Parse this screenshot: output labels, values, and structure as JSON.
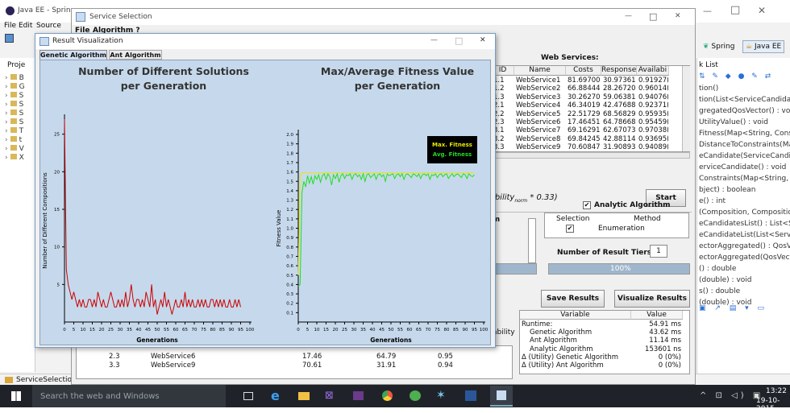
{
  "eclipse": {
    "title": "Java EE - Spring",
    "menu": [
      "File",
      "Edit",
      "Source"
    ],
    "persp_spring": "Spring",
    "persp_javaee": "Java EE",
    "status": "ServiceSelection",
    "win_min": "—",
    "win_max": "□",
    "win_close": "✕",
    "explorer_title": "Proje",
    "task_list": "k List",
    "outline": [
      "tion()",
      "tion(List<ServiceCandidate>,",
      "gregatedQosVector() : void",
      "UtilityValue() : void",
      "Fitness(Map<String, Constrai",
      "DistanceToConstraints(Map<",
      "eCandidate(ServiceCandidat",
      "erviceCandidate() : void",
      "Constraints(Map<String, Cons",
      "bject) : boolean",
      "e() : int",
      "(Composition, Composition)",
      "eCandidatesList() : List<Servi",
      "eCandidateList(List<ServiceC",
      "ectorAggregated() : QosVecto",
      "ectorAggregated(QosVector) :",
      "() : double",
      "(double) : void",
      "s() : double",
      "(double) : void"
    ],
    "tree_letters": [
      "B",
      "G",
      "S",
      "S",
      "S",
      "S",
      "T",
      "t",
      "V",
      "X"
    ]
  },
  "service_window": {
    "title": "Service Selection",
    "menu": [
      "File",
      "Algorithm ?"
    ],
    "min": "—",
    "max": "□",
    "close": "✕",
    "web_services_label": "Web Services:",
    "table_headers": [
      "ID",
      "Name",
      "Costs",
      "Response...",
      "Availabi"
    ],
    "table_rows": [
      [
        "1.1",
        "WebService1",
        "81.697006...",
        "30.973611...",
        "0.91927("
      ],
      [
        "1.2",
        "WebService2",
        "66.884446...",
        "28.267207...",
        "0.96014("
      ],
      [
        "1.3",
        "WebService3",
        "30.262705...",
        "59.063816...",
        "0.94076("
      ],
      [
        "2.1",
        "WebService4",
        "46.340191...",
        "42.476883...",
        "0.92371("
      ],
      [
        "2.2",
        "WebService5",
        "22.517299...",
        "68.568296...",
        "0.95935("
      ],
      [
        "2.3",
        "WebService6",
        "17.464519...",
        "64.786681...",
        "0.95459("
      ],
      [
        "3.1",
        "WebService7",
        "69.162911...",
        "62.670730...",
        "0.97038("
      ],
      [
        "3.2",
        "WebService8",
        "69.842455...",
        "42.881149...",
        "0.93695("
      ],
      [
        "3.3",
        "WebService9",
        "70.608471...",
        "31.908937...",
        "0.94089("
      ]
    ],
    "formula": "ailability",
    "formula_sub": "norm",
    "formula_tail": "* 0.33)",
    "start": "Start",
    "algo_label": "ithm",
    "analytic_label": "Analytic Algorithm",
    "sel_headers": [
      "Selection",
      "Method"
    ],
    "sel_method": "Enumeration",
    "tiers_label": "Number of Result Tiers:",
    "tiers_value": "1",
    "progress": "100%",
    "progress_value": 100,
    "save_btn": "Save Results",
    "visualize_btn": "Visualize Results",
    "res_headers": [
      "Variable",
      "Value"
    ],
    "res_rows": [
      [
        "Runtime:",
        "54.91 ms"
      ],
      [
        "Genetic Algorithm",
        "43.62 ms"
      ],
      [
        "Ant Algorithm",
        "11.14 ms"
      ],
      [
        "Analytic Algorithm",
        "153601 ns"
      ],
      [
        "Δ (Utility) Genetic Algorithm",
        "0 (0%)"
      ],
      [
        "Δ (Utility) Ant Algorithm",
        "0 (0%)"
      ]
    ],
    "bottom_rows": [
      [
        "2.3",
        "WebService6",
        "17.46",
        "64.79",
        "0.95"
      ],
      [
        "3.3",
        "WebService9",
        "70.61",
        "31.91",
        "0.94"
      ]
    ],
    "partial_label": "ability"
  },
  "result_window": {
    "title": "Result Visualization",
    "min": "—",
    "max": "□",
    "close": "✕",
    "tabs": [
      "Genetic Algorithm",
      "Ant Algorithm"
    ]
  },
  "taskbar": {
    "search": "Search the web and Windows",
    "time": "13:22",
    "date": "19-10-2015"
  },
  "chart_data": [
    {
      "type": "line",
      "title": "Number of Different Solutions per Generation",
      "title_lines": [
        "Number of Different Solutions",
        "per Generation"
      ],
      "xlabel": "Generations",
      "ylabel": "Number of Different Compositions",
      "ylim": [
        0,
        27
      ],
      "yticks": [
        5,
        10,
        15,
        20,
        25
      ],
      "xticks": [
        0,
        5,
        10,
        15,
        20,
        25,
        30,
        35,
        40,
        45,
        50,
        55,
        60,
        65,
        70,
        75,
        80,
        85,
        90,
        95,
        100
      ],
      "grid": false,
      "series": [
        {
          "color": "#cc0000",
          "x": [
            0,
            1,
            2,
            3,
            4,
            5,
            6,
            7,
            8,
            9,
            10,
            11,
            12,
            13,
            14,
            15,
            16,
            17,
            18,
            19,
            20,
            21,
            22,
            23,
            24,
            25,
            26,
            27,
            28,
            29,
            30,
            31,
            32,
            33,
            34,
            35,
            36,
            37,
            38,
            39,
            40,
            41,
            42,
            43,
            44,
            45,
            46,
            47,
            48,
            49,
            50,
            51,
            52,
            53,
            54,
            55,
            56,
            57,
            58,
            59,
            60,
            61,
            62,
            63,
            64,
            65,
            66,
            67,
            68,
            69,
            70,
            71,
            72,
            73,
            74,
            75,
            76,
            77,
            78,
            79,
            80,
            81,
            82,
            83,
            84,
            85,
            86,
            87,
            88,
            89,
            90,
            91,
            92,
            93,
            94,
            95
          ],
          "y": [
            27,
            7,
            5,
            4,
            3,
            4,
            3,
            2,
            3,
            2,
            3,
            2,
            2,
            3,
            3,
            2,
            3,
            2,
            4,
            3,
            2,
            3,
            2,
            2,
            3,
            4,
            3,
            2,
            2,
            3,
            2,
            3,
            2,
            4,
            2,
            3,
            5,
            3,
            2,
            3,
            3,
            2,
            3,
            2,
            4,
            3,
            2,
            5,
            2,
            3,
            1,
            2,
            3,
            2,
            4,
            2,
            3,
            2,
            1,
            2,
            3,
            2,
            2,
            3,
            2,
            4,
            2,
            3,
            2,
            3,
            2,
            2,
            3,
            2,
            3,
            2,
            3,
            2,
            2,
            3,
            3,
            2,
            3,
            2,
            3,
            2,
            3,
            2,
            2,
            3,
            2,
            2,
            3,
            2,
            3,
            2
          ]
        }
      ]
    },
    {
      "type": "line",
      "title": "Max/Average Fitness Value per Generation",
      "title_lines": [
        "Max/Average Fitness Value",
        "per Generation"
      ],
      "xlabel": "Generations",
      "ylabel": "Fitness Value",
      "ylim": [
        0,
        2.0
      ],
      "yticks": [
        0.1,
        0.2,
        0.3,
        0.4,
        0.5,
        0.6,
        0.7,
        0.8,
        0.9,
        1.0,
        1.1,
        1.2,
        1.3,
        1.4,
        1.5,
        1.6,
        1.7,
        1.8,
        1.9,
        2.0
      ],
      "xticks": [
        0,
        5,
        10,
        15,
        20,
        25,
        30,
        35,
        40,
        45,
        50,
        55,
        60,
        65,
        70,
        75,
        80,
        85,
        90,
        95,
        100
      ],
      "grid": false,
      "legend": [
        "Max. Fitness",
        "Avg. Fitness"
      ],
      "series": [
        {
          "name": "Max. Fitness",
          "color": "#e8e800",
          "x": [
            0,
            1,
            2,
            3,
            4,
            5,
            6,
            7,
            8,
            9,
            10,
            11,
            12,
            13,
            14,
            15,
            16,
            17,
            18,
            19,
            20,
            21,
            22,
            23,
            24,
            25,
            26,
            27,
            28,
            29,
            30,
            31,
            32,
            33,
            34,
            35,
            36,
            37,
            38,
            39,
            40,
            41,
            42,
            43,
            44,
            45,
            46,
            47,
            48,
            49,
            50,
            51,
            52,
            53,
            54,
            55,
            56,
            57,
            58,
            59,
            60,
            61,
            62,
            63,
            64,
            65,
            66,
            67,
            68,
            69,
            70,
            71,
            72,
            73,
            74,
            75,
            76,
            77,
            78,
            79,
            80,
            81,
            82,
            83,
            84,
            85,
            86,
            87,
            88,
            89,
            90,
            91,
            92,
            93,
            94,
            95
          ],
          "y": [
            0.5,
            1.55,
            1.59,
            1.59,
            1.59,
            1.59,
            1.59,
            1.59,
            1.59,
            1.59,
            1.59,
            1.59,
            1.59,
            1.59,
            1.59,
            1.59,
            1.59,
            1.59,
            1.59,
            1.59,
            1.59,
            1.59,
            1.59,
            1.59,
            1.59,
            1.59,
            1.59,
            1.59,
            1.59,
            1.59,
            1.59,
            1.59,
            1.59,
            1.59,
            1.59,
            1.59,
            1.59,
            1.59,
            1.59,
            1.59,
            1.59,
            1.59,
            1.59,
            1.59,
            1.59,
            1.59,
            1.59,
            1.59,
            1.59,
            1.59,
            1.59,
            1.59,
            1.59,
            1.59,
            1.59,
            1.59,
            1.59,
            1.59,
            1.59,
            1.59,
            1.59,
            1.59,
            1.59,
            1.59,
            1.59,
            1.59,
            1.59,
            1.59,
            1.59,
            1.59,
            1.59,
            1.59,
            1.59,
            1.59,
            1.59,
            1.59,
            1.59,
            1.59,
            1.59,
            1.59,
            1.59,
            1.59,
            1.59,
            1.59,
            1.59,
            1.59,
            1.59,
            1.59,
            1.59,
            1.59,
            1.59,
            1.59,
            1.59,
            1.59,
            1.59,
            1.59
          ]
        },
        {
          "name": "Avg. Fitness",
          "color": "#22dd22",
          "x": [
            0,
            1,
            2,
            3,
            4,
            5,
            6,
            7,
            8,
            9,
            10,
            11,
            12,
            13,
            14,
            15,
            16,
            17,
            18,
            19,
            20,
            21,
            22,
            23,
            24,
            25,
            26,
            27,
            28,
            29,
            30,
            31,
            32,
            33,
            34,
            35,
            36,
            37,
            38,
            39,
            40,
            41,
            42,
            43,
            44,
            45,
            46,
            47,
            48,
            49,
            50,
            51,
            52,
            53,
            54,
            55,
            56,
            57,
            58,
            59,
            60,
            61,
            62,
            63,
            64,
            65,
            66,
            67,
            68,
            69,
            70,
            71,
            72,
            73,
            74,
            75,
            76,
            77,
            78,
            79,
            80,
            81,
            82,
            83,
            84,
            85,
            86,
            87,
            88,
            89,
            90,
            91,
            92,
            93,
            94,
            95
          ],
          "y": [
            0.38,
            0.4,
            1.38,
            1.5,
            1.44,
            1.56,
            1.48,
            1.55,
            1.47,
            1.56,
            1.52,
            1.57,
            1.49,
            1.56,
            1.58,
            1.52,
            1.58,
            1.55,
            1.46,
            1.57,
            1.53,
            1.58,
            1.49,
            1.56,
            1.58,
            1.53,
            1.57,
            1.56,
            1.58,
            1.52,
            1.57,
            1.58,
            1.55,
            1.57,
            1.52,
            1.58,
            1.5,
            1.57,
            1.58,
            1.54,
            1.56,
            1.58,
            1.52,
            1.57,
            1.58,
            1.55,
            1.57,
            1.5,
            1.58,
            1.56,
            1.57,
            1.58,
            1.53,
            1.57,
            1.58,
            1.55,
            1.58,
            1.52,
            1.57,
            1.58,
            1.56,
            1.54,
            1.58,
            1.57,
            1.55,
            1.58,
            1.53,
            1.57,
            1.58,
            1.56,
            1.58,
            1.52,
            1.57,
            1.56,
            1.58,
            1.54,
            1.57,
            1.58,
            1.55,
            1.57,
            1.58,
            1.53,
            1.56,
            1.58,
            1.55,
            1.57,
            1.58,
            1.56,
            1.54,
            1.58,
            1.57,
            1.53,
            1.58,
            1.56,
            1.55,
            1.57
          ]
        }
      ]
    }
  ]
}
